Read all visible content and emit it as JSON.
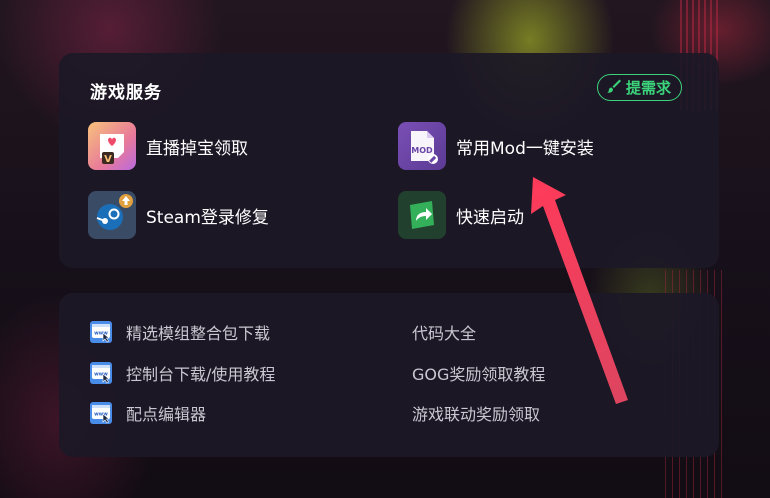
{
  "services_panel": {
    "title": "游戏服务",
    "request_button": "提需求",
    "items": [
      {
        "label": "直播掉宝领取",
        "icon": "live-drops-icon"
      },
      {
        "label": "常用Mod一键安装",
        "icon": "mod-install-icon"
      },
      {
        "label": "Steam登录修复",
        "icon": "steam-icon"
      },
      {
        "label": "快速启动",
        "icon": "quick-launch-icon"
      }
    ]
  },
  "links_panel": {
    "left": [
      {
        "label": "精选模组整合包下载",
        "icon": "www-icon"
      },
      {
        "label": "控制台下载/使用教程",
        "icon": "www-icon"
      },
      {
        "label": "配点编辑器",
        "icon": "www-icon"
      }
    ],
    "right": [
      {
        "label": "代码大全"
      },
      {
        "label": "GOG奖励领取教程"
      },
      {
        "label": "游戏联动奖励领取"
      }
    ]
  },
  "mod_icon_text": "MOD",
  "colors": {
    "accent_green": "#3bd27a",
    "annotation_arrow": "#ff4d6a",
    "panel_bg": "#1c1826"
  }
}
